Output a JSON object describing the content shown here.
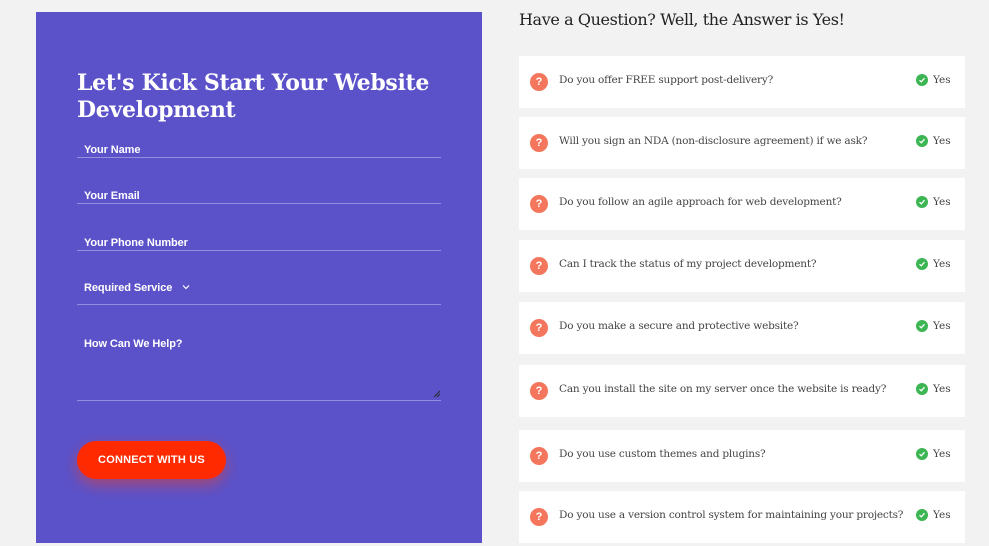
{
  "form": {
    "title": "Let's Kick Start Your Website Development",
    "fields": {
      "name_placeholder": "Your Name",
      "email_placeholder": "Your Email",
      "phone_placeholder": "Your Phone Number",
      "service_selected": "Required Service",
      "help_placeholder": "How Can We Help?"
    },
    "submit_label": "CONNECT WITH US"
  },
  "faq": {
    "heading": "Have a Question? Well, the Answer is Yes!",
    "items": [
      {
        "question": "Do you offer FREE support post-delivery?",
        "answer": "Yes"
      },
      {
        "question": "Will you sign an NDA (non-disclosure agreement) if we ask?",
        "answer": "Yes"
      },
      {
        "question": "Do you follow an agile approach for web development?",
        "answer": "Yes"
      },
      {
        "question": "Can I track the status of my project development?",
        "answer": "Yes"
      },
      {
        "question": "Do you make a secure and protective website?",
        "answer": "Yes"
      },
      {
        "question": "Can you install the site on my server once the website is ready?",
        "answer": "Yes"
      },
      {
        "question": "Do you use custom themes and plugins?",
        "answer": "Yes"
      },
      {
        "question": "Do you use a version control system for maintaining your projects?",
        "answer": "Yes"
      }
    ]
  },
  "colors": {
    "form_background": "#5b52c9",
    "cta_background": "#ff2a00",
    "question_icon": "#f4775d",
    "check_icon": "#3cb553"
  },
  "icons": {
    "question": "question-mark-circle",
    "answer": "check-circle",
    "select": "chevron-down"
  }
}
